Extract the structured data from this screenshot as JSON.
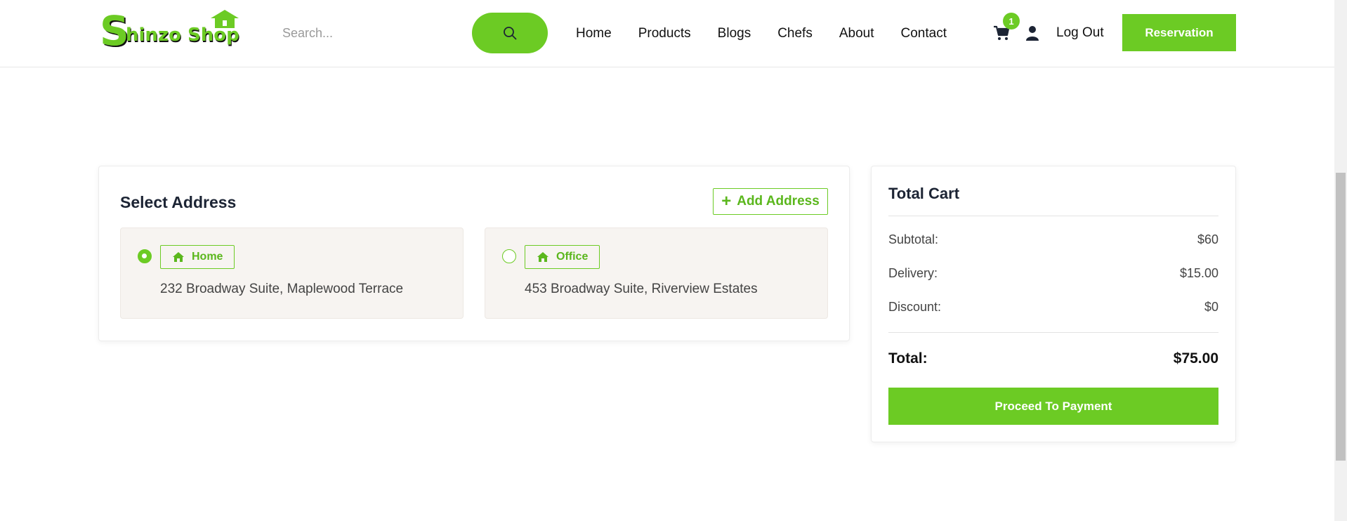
{
  "header": {
    "logo_text": "Shinzo Shop",
    "search_placeholder": "Search...",
    "nav": [
      "Home",
      "Products",
      "Blogs",
      "Chefs",
      "About",
      "Contact"
    ],
    "cart_count": "1",
    "logout_label": "Log Out",
    "reservation_label": "Reservation"
  },
  "address": {
    "title": "Select Address",
    "add_button_label": "Add Address",
    "options": [
      {
        "tag": "Home",
        "address": "232 Broadway Suite, Maplewood Terrace",
        "selected": true
      },
      {
        "tag": "Office",
        "address": "453 Broadway Suite, Riverview Estates",
        "selected": false
      }
    ]
  },
  "cart_summary": {
    "title": "Total Cart",
    "subtotal_label": "Subtotal:",
    "subtotal_value": "$60",
    "delivery_label": "Delivery:",
    "delivery_value": "$15.00",
    "discount_label": "Discount:",
    "discount_value": "$0",
    "total_label": "Total:",
    "total_value": "$75.00",
    "proceed_label": "Proceed To Payment"
  },
  "colors": {
    "accent": "#6ccb24",
    "text_dark": "#1c2434",
    "option_bg": "#f7f4f1"
  },
  "icons": [
    "search-icon",
    "cart-icon",
    "user-icon",
    "plus-icon",
    "home-icon",
    "radio-selected",
    "radio-unselected"
  ]
}
